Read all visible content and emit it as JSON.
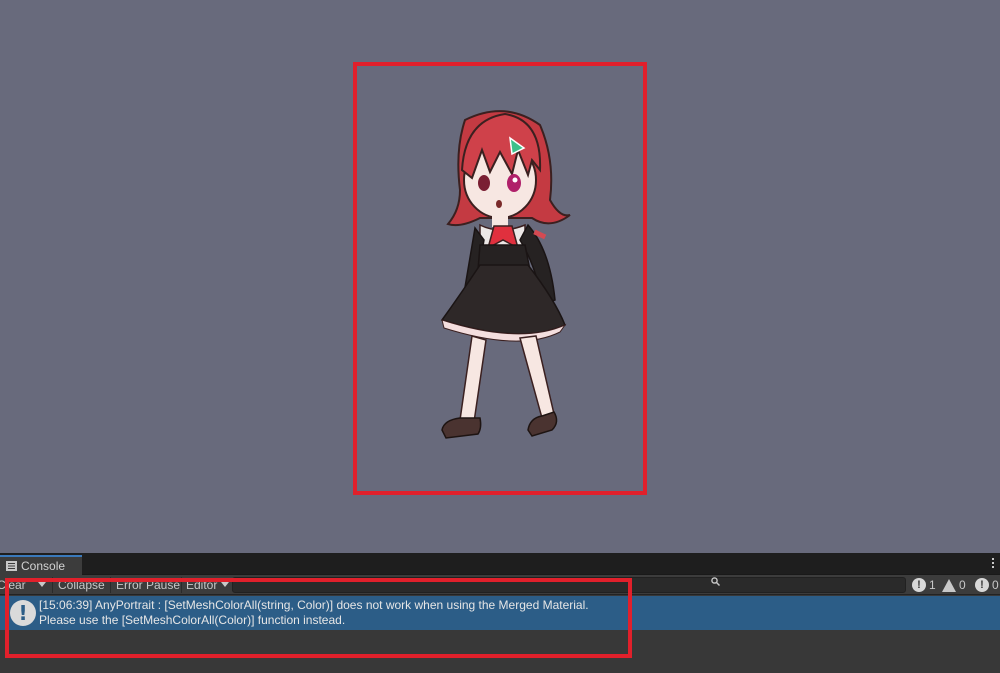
{
  "scene": {
    "background_color": "#686a7c",
    "highlight_color": "#e1202b"
  },
  "console": {
    "tab_label": "Console",
    "tab_icon": "console-list-icon",
    "toolbar": {
      "clear_label": "Clear",
      "collapse_label": "Collapse",
      "error_pause_label": "Error Pause",
      "editor_label": "Editor",
      "search_placeholder": "",
      "log_count": "1",
      "warning_count": "0",
      "error_count": "0"
    },
    "entries": [
      {
        "type": "info",
        "icon": "info-exclamation-icon",
        "line1": "[15:06:39] AnyPortrait : [SetMeshColorAll(string, Color)] does not work when using the Merged Material.",
        "line2": "Please use the [SetMeshColorAll(Color)] function instead."
      }
    ]
  }
}
